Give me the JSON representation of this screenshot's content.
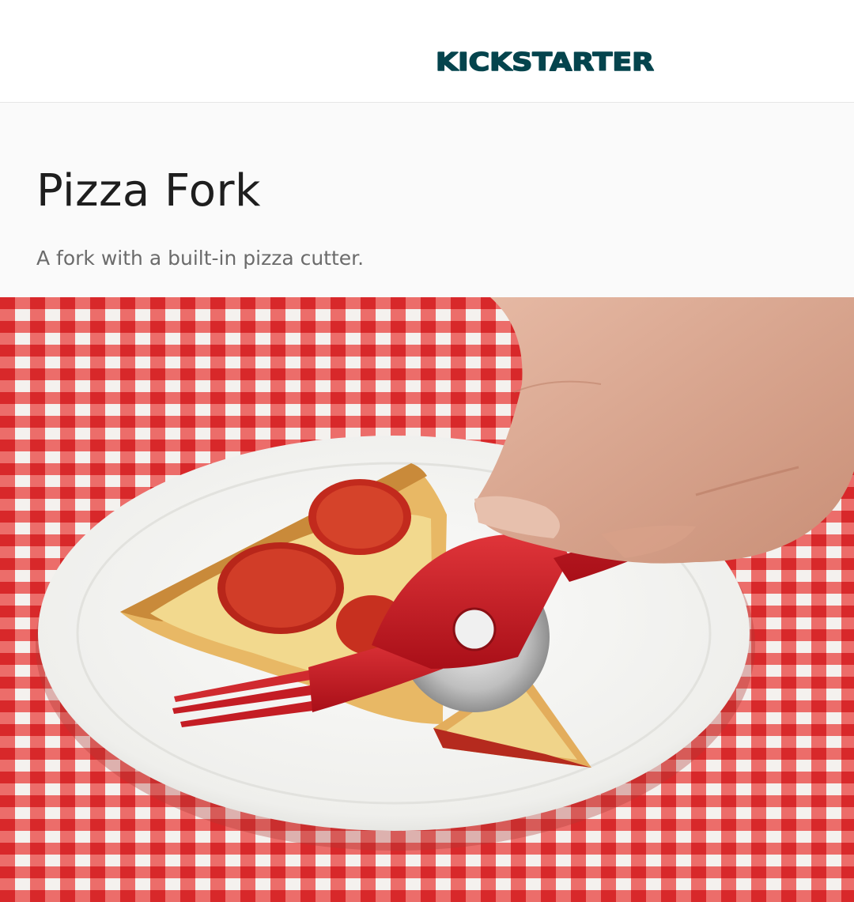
{
  "header": {
    "logo_text": "KICKSTARTER",
    "logo_color": "#05444d"
  },
  "project": {
    "title": "Pizza Fork",
    "blurb": "A fork with a built-in pizza cutter."
  },
  "hero": {
    "alt": "Hand using a red pizza fork to cut a pepperoni pizza slice on a white plate over a red checkered tablecloth"
  },
  "colors": {
    "tablecloth_red": "#e5322f",
    "tablecloth_white": "#f4f1ee",
    "fork_red": "#c9161f",
    "plate": "#f3f3f1"
  }
}
